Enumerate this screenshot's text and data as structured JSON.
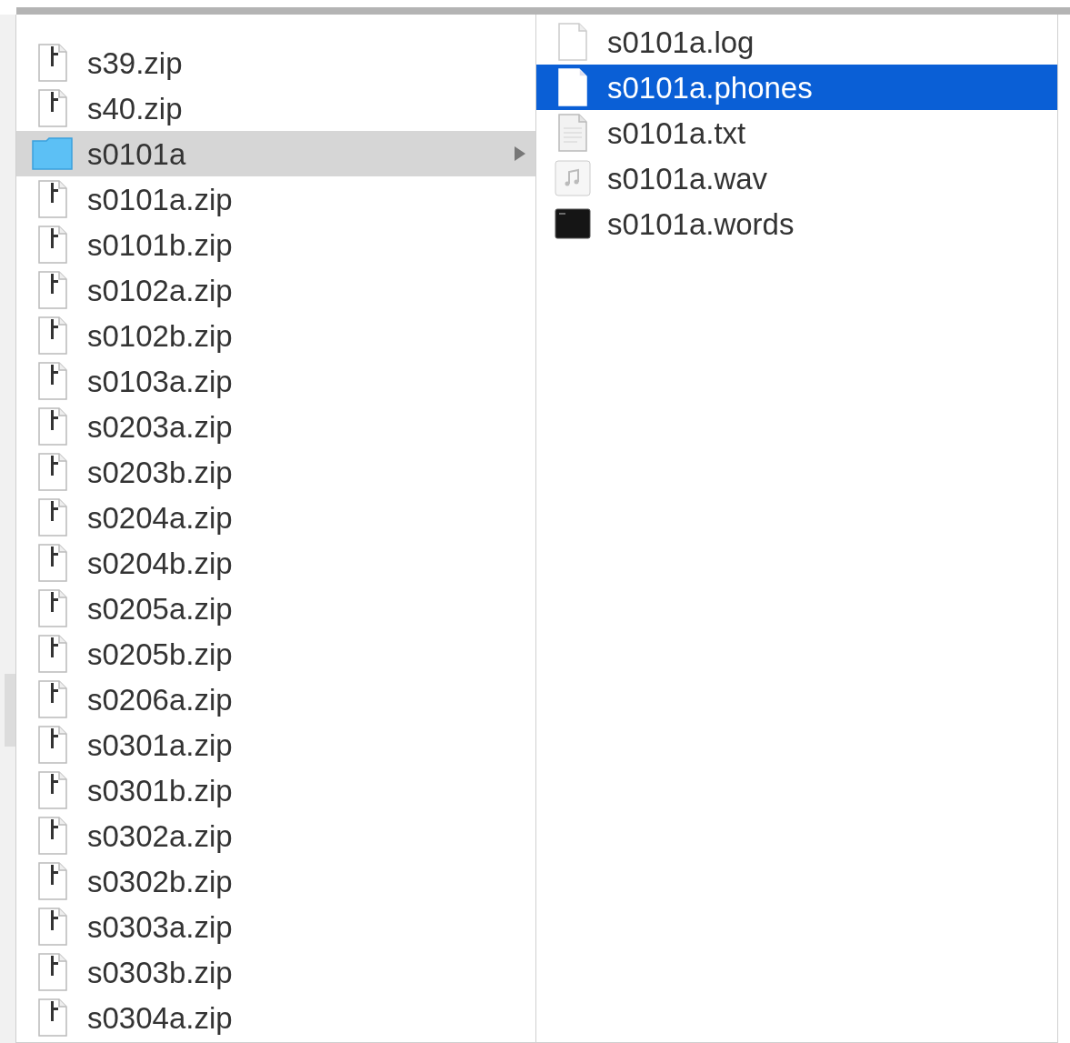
{
  "left_column": {
    "items": [
      {
        "name": "s39.zip",
        "kind": "zip",
        "selected": false
      },
      {
        "name": "s40.zip",
        "kind": "zip",
        "selected": false
      },
      {
        "name": "s0101a",
        "kind": "folder",
        "selected": true
      },
      {
        "name": "s0101a.zip",
        "kind": "zip",
        "selected": false
      },
      {
        "name": "s0101b.zip",
        "kind": "zip",
        "selected": false
      },
      {
        "name": "s0102a.zip",
        "kind": "zip",
        "selected": false
      },
      {
        "name": "s0102b.zip",
        "kind": "zip",
        "selected": false
      },
      {
        "name": "s0103a.zip",
        "kind": "zip",
        "selected": false
      },
      {
        "name": "s0203a.zip",
        "kind": "zip",
        "selected": false
      },
      {
        "name": "s0203b.zip",
        "kind": "zip",
        "selected": false
      },
      {
        "name": "s0204a.zip",
        "kind": "zip",
        "selected": false
      },
      {
        "name": "s0204b.zip",
        "kind": "zip",
        "selected": false
      },
      {
        "name": "s0205a.zip",
        "kind": "zip",
        "selected": false
      },
      {
        "name": "s0205b.zip",
        "kind": "zip",
        "selected": false
      },
      {
        "name": "s0206a.zip",
        "kind": "zip",
        "selected": false
      },
      {
        "name": "s0301a.zip",
        "kind": "zip",
        "selected": false
      },
      {
        "name": "s0301b.zip",
        "kind": "zip",
        "selected": false
      },
      {
        "name": "s0302a.zip",
        "kind": "zip",
        "selected": false
      },
      {
        "name": "s0302b.zip",
        "kind": "zip",
        "selected": false
      },
      {
        "name": "s0303a.zip",
        "kind": "zip",
        "selected": false
      },
      {
        "name": "s0303b.zip",
        "kind": "zip",
        "selected": false
      },
      {
        "name": "s0304a.zip",
        "kind": "zip",
        "selected": false
      }
    ]
  },
  "right_column": {
    "items": [
      {
        "name": "s0101a.log",
        "kind": "document",
        "selected": false
      },
      {
        "name": "s0101a.phones",
        "kind": "document",
        "selected": true
      },
      {
        "name": "s0101a.txt",
        "kind": "text",
        "selected": false
      },
      {
        "name": "s0101a.wav",
        "kind": "audio",
        "selected": false
      },
      {
        "name": "s0101a.words",
        "kind": "terminal",
        "selected": false
      }
    ]
  }
}
